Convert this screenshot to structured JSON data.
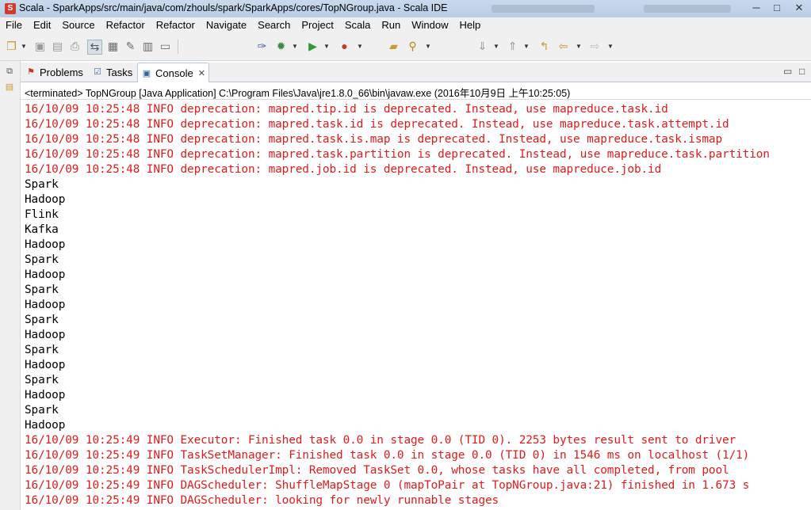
{
  "window": {
    "title": "Scala - SparkApps/src/main/java/com/zhouls/spark/SparkApps/cores/TopNGroup.java - Scala IDE",
    "app_icon": "scala-ide-icon",
    "controls": {
      "minimize": "─",
      "maximize": "□",
      "close": "✕"
    }
  },
  "menu": [
    "File",
    "Edit",
    "Source",
    "Refactor",
    "Refactor",
    "Navigate",
    "Search",
    "Project",
    "Scala",
    "Run",
    "Window",
    "Help"
  ],
  "tabs": [
    {
      "label": "Problems",
      "icon": "problems-icon",
      "active": false
    },
    {
      "label": "Tasks",
      "icon": "tasks-icon",
      "active": false
    },
    {
      "label": "Console",
      "icon": "console-icon",
      "active": true,
      "close": "✕"
    }
  ],
  "console": {
    "process_label": "<terminated> TopNGroup [Java Application] C:\\Program Files\\Java\\jre1.8.0_66\\bin\\javaw.exe (2016年10月9日 上午10:25:05)",
    "lines": [
      {
        "text": "16/10/09 10:25:48 INFO deprecation: mapred.tip.id is deprecated. Instead, use mapreduce.task.id",
        "color": "red"
      },
      {
        "text": "16/10/09 10:25:48 INFO deprecation: mapred.task.id is deprecated. Instead, use mapreduce.task.attempt.id",
        "color": "red"
      },
      {
        "text": "16/10/09 10:25:48 INFO deprecation: mapred.task.is.map is deprecated. Instead, use mapreduce.task.ismap",
        "color": "red"
      },
      {
        "text": "16/10/09 10:25:48 INFO deprecation: mapred.task.partition is deprecated. Instead, use mapreduce.task.partition",
        "color": "red"
      },
      {
        "text": "16/10/09 10:25:48 INFO deprecation: mapred.job.id is deprecated. Instead, use mapreduce.job.id",
        "color": "red"
      },
      {
        "text": "Spark",
        "color": "black"
      },
      {
        "text": "Hadoop",
        "color": "black"
      },
      {
        "text": "Flink",
        "color": "black"
      },
      {
        "text": "Kafka",
        "color": "black"
      },
      {
        "text": "Hadoop",
        "color": "black"
      },
      {
        "text": "Spark",
        "color": "black"
      },
      {
        "text": "Hadoop",
        "color": "black"
      },
      {
        "text": "Spark",
        "color": "black"
      },
      {
        "text": "Hadoop",
        "color": "black"
      },
      {
        "text": "Spark",
        "color": "black"
      },
      {
        "text": "Hadoop",
        "color": "black"
      },
      {
        "text": "Spark",
        "color": "black"
      },
      {
        "text": "Hadoop",
        "color": "black"
      },
      {
        "text": "Spark",
        "color": "black"
      },
      {
        "text": "Hadoop",
        "color": "black"
      },
      {
        "text": "Spark",
        "color": "black"
      },
      {
        "text": "Hadoop",
        "color": "black"
      },
      {
        "text": "16/10/09 10:25:49 INFO Executor: Finished task 0.0 in stage 0.0 (TID 0). 2253 bytes result sent to driver",
        "color": "red"
      },
      {
        "text": "16/10/09 10:25:49 INFO TaskSetManager: Finished task 0.0 in stage 0.0 (TID 0) in 1546 ms on localhost (1/1)",
        "color": "red"
      },
      {
        "text": "16/10/09 10:25:49 INFO TaskSchedulerImpl: Removed TaskSet 0.0, whose tasks have all completed, from pool",
        "color": "red"
      },
      {
        "text": "16/10/09 10:25:49 INFO DAGScheduler: ShuffleMapStage 0 (mapToPair at TopNGroup.java:21) finished in 1.673 s",
        "color": "red"
      },
      {
        "text": "16/10/09 10:25:49 INFO DAGScheduler: looking for newly runnable stages",
        "color": "red"
      }
    ]
  },
  "colors": {
    "error_text": "#e01b1b",
    "normal_text": "#000000"
  }
}
